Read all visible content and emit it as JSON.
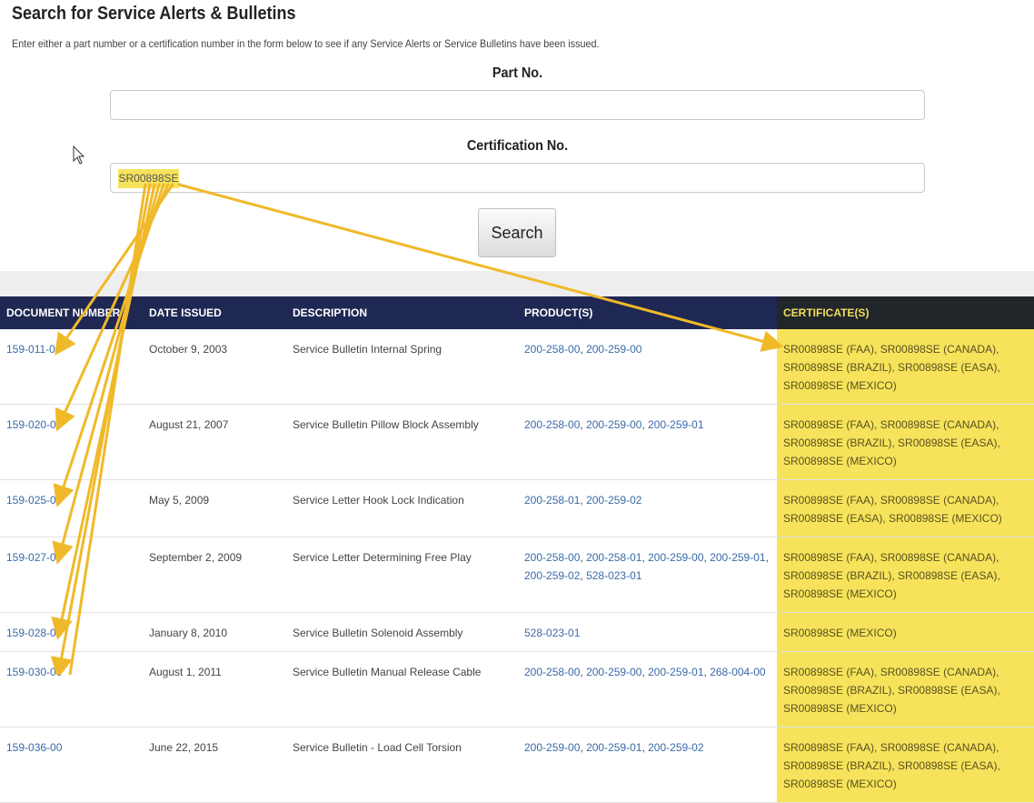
{
  "page": {
    "title": "Search for Service Alerts & Bulletins",
    "intro": "Enter either a part number or a certification number in the form below to see if any Service Alerts or Service Bulletins have been issued."
  },
  "form": {
    "part_label": "Part No.",
    "part_value": "",
    "cert_label": "Certification No.",
    "cert_value": "SR00898SE",
    "search_label": "Search"
  },
  "table": {
    "headers": [
      "Document Number",
      "Date Issued",
      "Description",
      "Product(s)",
      "Certificate(s)"
    ],
    "rows": [
      {
        "doc": "159-011-00",
        "date": "October 9, 2003",
        "description": "Service Bulletin Internal Spring",
        "products": [
          "200-258-00",
          "200-259-00"
        ],
        "certificates": "SR00898SE (FAA), SR00898SE (CANADA), SR00898SE (BRAZIL), SR00898SE (EASA), SR00898SE (MEXICO)"
      },
      {
        "doc": "159-020-00",
        "date": "August 21, 2007",
        "description": "Service Bulletin Pillow Block Assembly",
        "products": [
          "200-258-00",
          "200-259-00",
          "200-259-01"
        ],
        "certificates": "SR00898SE (FAA), SR00898SE (CANADA), SR00898SE (BRAZIL), SR00898SE (EASA), SR00898SE (MEXICO)"
      },
      {
        "doc": "159-025-00",
        "date": "May 5, 2009",
        "description": "Service Letter Hook Lock Indication",
        "products": [
          "200-258-01",
          "200-259-02"
        ],
        "certificates": "SR00898SE (FAA), SR00898SE (CANADA), SR00898SE (EASA), SR00898SE (MEXICO)"
      },
      {
        "doc": "159-027-00",
        "date": "September 2, 2009",
        "description": "Service Letter Determining Free Play",
        "products": [
          "200-258-00",
          "200-258-01",
          "200-259-00",
          "200-259-01",
          "200-259-02",
          "528-023-01"
        ],
        "certificates": "SR00898SE (FAA), SR00898SE (CANADA), SR00898SE (BRAZIL), SR00898SE (EASA), SR00898SE (MEXICO)"
      },
      {
        "doc": "159-028-00",
        "date": "January 8, 2010",
        "description": "Service Bulletin Solenoid Assembly",
        "products": [
          "528-023-01"
        ],
        "certificates": "SR00898SE (MEXICO)"
      },
      {
        "doc": "159-030-00",
        "date": "August 1, 2011",
        "description": "Service Bulletin Manual Release Cable",
        "products": [
          "200-258-00",
          "200-259-00",
          "200-259-01",
          "268-004-00"
        ],
        "certificates": "SR00898SE (FAA), SR00898SE (CANADA), SR00898SE (BRAZIL), SR00898SE (EASA), SR00898SE (MEXICO)"
      },
      {
        "doc": "159-036-00",
        "date": "June 22, 2015",
        "description": "Service Bulletin - Load Cell Torsion",
        "products": [
          "200-259-00",
          "200-259-01",
          "200-259-02"
        ],
        "certificates": "SR00898SE (FAA), SR00898SE (CANADA), SR00898SE (BRAZIL), SR00898SE (EASA), SR00898SE (MEXICO)"
      }
    ]
  },
  "annotations": {
    "highlight_color": "#f6e35b",
    "arrow_color": "#f0b92a"
  }
}
